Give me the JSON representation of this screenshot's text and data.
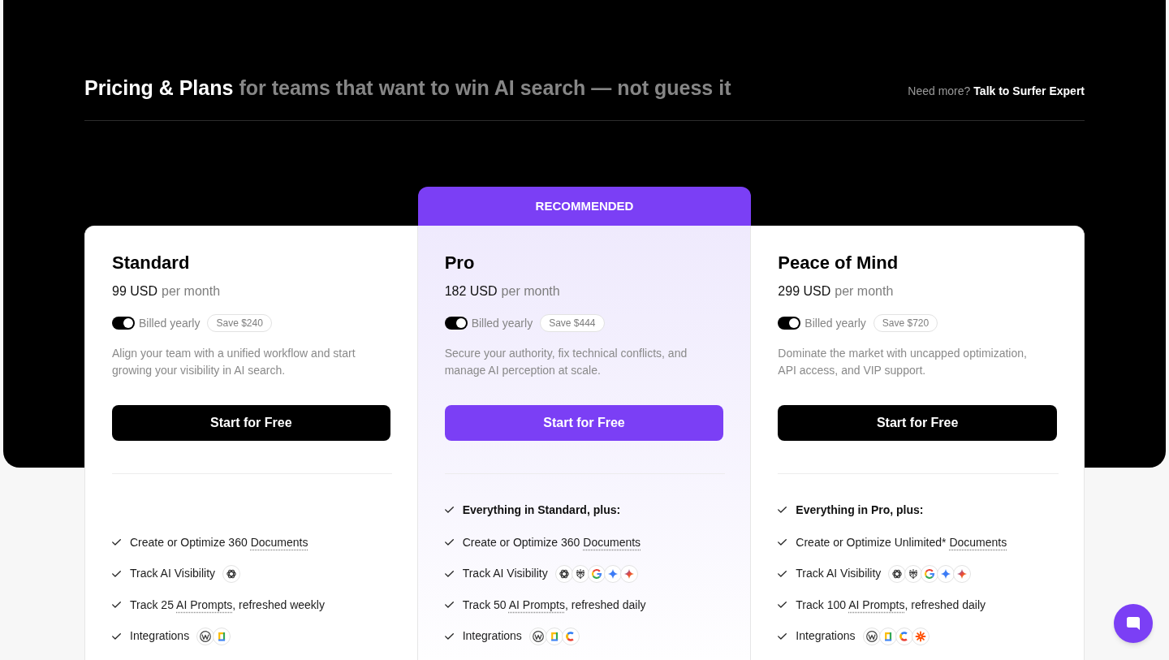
{
  "header": {
    "title": "Pricing & Plans",
    "subtitle": "for teams that want to win AI search — not guess it",
    "contact_prompt": "Need more?",
    "contact_link": "Talk to Surfer Expert"
  },
  "plans": [
    {
      "name": "Standard",
      "recommended": false,
      "price": "99 USD",
      "period": "per month",
      "toggle": {
        "label": "Billed yearly",
        "on": true
      },
      "savings": "Save $240",
      "description": "Align your team with a unified workflow and start growing your visibility in AI search.",
      "cta": "Start for Free",
      "features": [
        {
          "parts": [
            {
              "text": "Create or Optimize 360 ",
              "kind": "plain"
            },
            {
              "text": "Documents",
              "kind": "term"
            }
          ]
        },
        {
          "parts": [
            {
              "text": "Track AI Visibility",
              "kind": "plain"
            }
          ],
          "icons": [
            {
              "kind": "knot"
            }
          ]
        },
        {
          "parts": [
            {
              "text": "Track 25 ",
              "kind": "plain"
            },
            {
              "text": "AI Prompts",
              "kind": "term"
            },
            {
              "text": ", refreshed weekly",
              "kind": "plain"
            }
          ]
        },
        {
          "parts": [
            {
              "text": "Integrations",
              "kind": "plain"
            }
          ],
          "icons": [
            {
              "kind": "w"
            },
            {
              "kind": "doc"
            }
          ]
        }
      ]
    },
    {
      "badge": "RECOMMENDED",
      "name": "Pro",
      "recommended": true,
      "price": "182 USD",
      "period": "per month",
      "toggle": {
        "label": "Billed yearly",
        "on": true
      },
      "savings": "Save $444",
      "description": "Secure your authority, fix technical conflicts, and manage AI perception at scale.",
      "cta": "Start for Free",
      "intro": "Everything in Standard, plus:",
      "features": [
        {
          "parts": [
            {
              "text": "Create or Optimize 360 ",
              "kind": "plain"
            },
            {
              "text": "Documents",
              "kind": "term"
            }
          ]
        },
        {
          "parts": [
            {
              "text": "Track AI Visibility",
              "kind": "plain"
            }
          ],
          "icons": [
            {
              "kind": "knot"
            },
            {
              "kind": "lattice"
            },
            {
              "kind": "g"
            },
            {
              "kind": "sparkle"
            },
            {
              "kind": "gradient-sparkle"
            }
          ]
        },
        {
          "parts": [
            {
              "text": "Track 50 ",
              "kind": "plain"
            },
            {
              "text": "AI Prompts",
              "kind": "term"
            },
            {
              "text": ", refreshed daily",
              "kind": "plain"
            }
          ]
        },
        {
          "parts": [
            {
              "text": "Integrations",
              "kind": "plain"
            }
          ],
          "icons": [
            {
              "kind": "w"
            },
            {
              "kind": "doc"
            },
            {
              "kind": "c"
            }
          ]
        }
      ]
    },
    {
      "name": "Peace of Mind",
      "recommended": false,
      "price": "299 USD",
      "period": "per month",
      "toggle": {
        "label": "Billed yearly",
        "on": true
      },
      "savings": "Save $720",
      "description": "Dominate the market with uncapped optimization, API access, and VIP support.",
      "cta": "Start for Free",
      "intro": "Everything in Pro, plus:",
      "features": [
        {
          "parts": [
            {
              "text": "Create or Optimize Unlimited* ",
              "kind": "plain"
            },
            {
              "text": "Documents",
              "kind": "term"
            }
          ]
        },
        {
          "parts": [
            {
              "text": "Track AI Visibility",
              "kind": "plain"
            }
          ],
          "icons": [
            {
              "kind": "knot"
            },
            {
              "kind": "lattice"
            },
            {
              "kind": "g"
            },
            {
              "kind": "sparkle"
            },
            {
              "kind": "gradient-sparkle"
            }
          ]
        },
        {
          "parts": [
            {
              "text": "Track 100 ",
              "kind": "plain"
            },
            {
              "text": "AI Prompts",
              "kind": "term"
            },
            {
              "text": ", refreshed daily",
              "kind": "plain"
            }
          ]
        },
        {
          "parts": [
            {
              "text": "Integrations",
              "kind": "plain"
            }
          ],
          "icons": [
            {
              "kind": "w"
            },
            {
              "kind": "doc"
            },
            {
              "kind": "c"
            },
            {
              "kind": "asterisk"
            }
          ]
        }
      ]
    }
  ]
}
